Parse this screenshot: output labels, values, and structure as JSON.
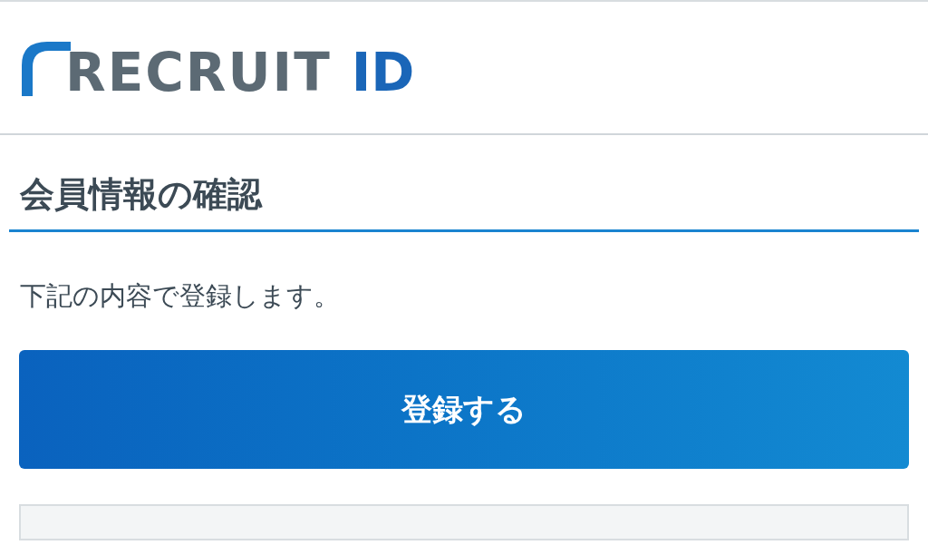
{
  "header": {
    "logo_text": "RECRUIT",
    "logo_suffix": "ID"
  },
  "title": "会員情報の確認",
  "message": "下記の内容で登録します。",
  "submit_button": "登録する"
}
